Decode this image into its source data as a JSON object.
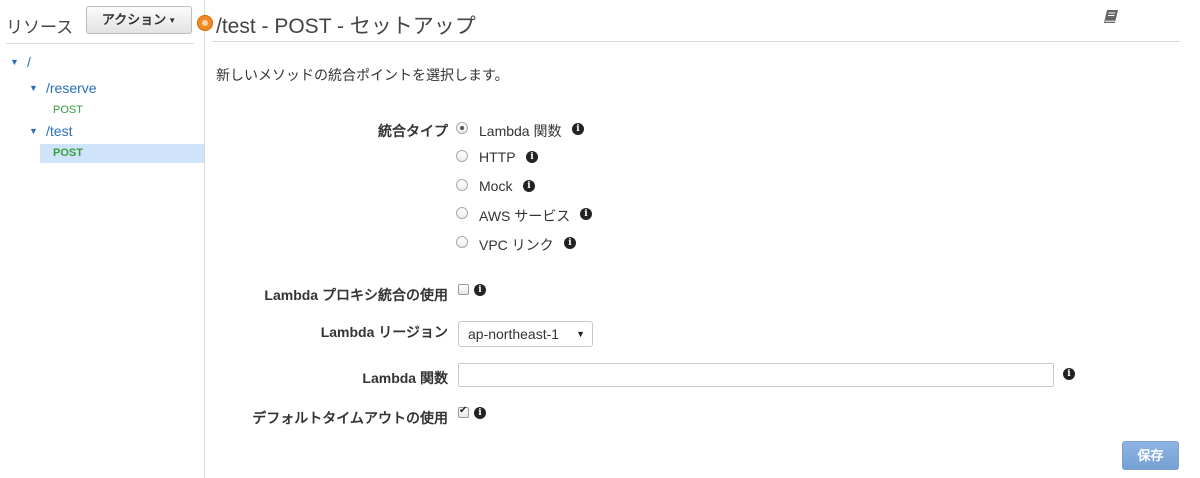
{
  "sidebar": {
    "title": "リソース",
    "actions_label": "アクション",
    "tree": [
      {
        "path": "/",
        "level": 0
      },
      {
        "path": "/reserve",
        "level": 1
      },
      {
        "method": "POST",
        "level": 2
      },
      {
        "path": "/test",
        "level": 1
      },
      {
        "method": "POST",
        "level": 2,
        "selected": true
      }
    ]
  },
  "main": {
    "title": "/test - POST - セットアップ",
    "description": "新しいメソッドの統合ポイントを選択します。",
    "info_glyph": "i",
    "integration_type": {
      "label": "統合タイプ",
      "options": [
        {
          "label": "Lambda 関数",
          "checked": true
        },
        {
          "label": "HTTP",
          "checked": false
        },
        {
          "label": "Mock",
          "checked": false
        },
        {
          "label": "AWS サービス",
          "checked": false
        },
        {
          "label": "VPC リンク",
          "checked": false
        }
      ]
    },
    "proxy": {
      "label": "Lambda プロキシ統合の使用",
      "checked": false
    },
    "region": {
      "label": "Lambda リージョン",
      "value": "ap-northeast-1"
    },
    "function": {
      "label": "Lambda 関数",
      "value": "",
      "placeholder": ""
    },
    "default_timeout": {
      "label": "デフォルトタイムアウトの使用",
      "checked": true
    },
    "save_label": "保存"
  },
  "colors": {
    "link": "#2a6ebb",
    "method": "#38a03a",
    "selected_row": "#cfe4fa",
    "marker": "#f08a24",
    "save_button": "#7fa9d9"
  },
  "icons": {
    "book": "book-icon",
    "info": "info-icon",
    "marker": "panel-marker-icon"
  }
}
